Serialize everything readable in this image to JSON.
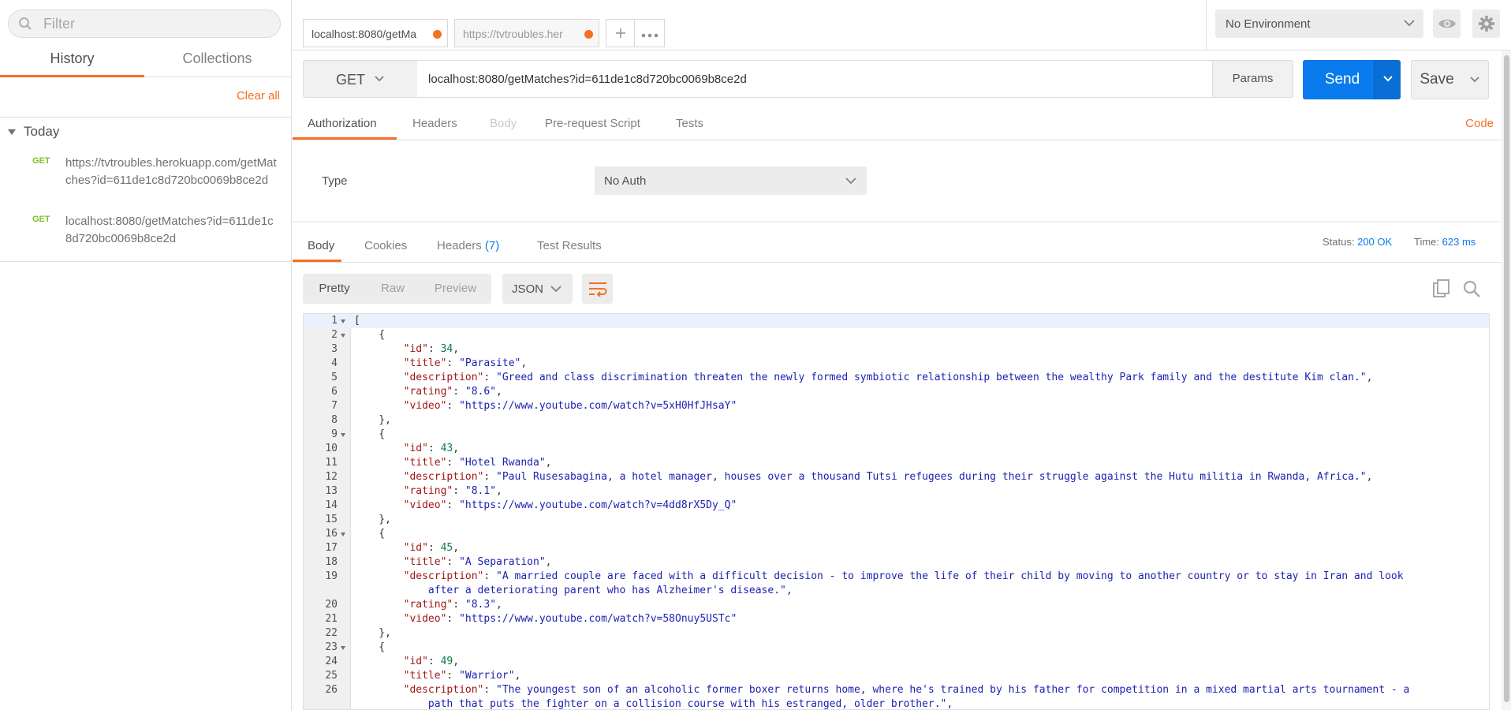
{
  "sidebar": {
    "filter_placeholder": "Filter",
    "tabs": [
      {
        "label": "History",
        "active": true
      },
      {
        "label": "Collections",
        "active": false
      }
    ],
    "clear_all": "Clear all",
    "group_label": "Today",
    "history": [
      {
        "method": "GET",
        "url": "https://tvtroubles.herokuapp.com/getMatches?id=611de1c8d720bc0069b8ce2d"
      },
      {
        "method": "GET",
        "url": "localhost:8080/getMatches?id=611de1c8d720bc0069b8ce2d"
      }
    ]
  },
  "tabs": [
    {
      "label": "localhost:8080/getMa",
      "unsaved": true,
      "active": true
    },
    {
      "label": "https://tvtroubles.her",
      "unsaved": true,
      "active": false
    }
  ],
  "environment": {
    "selected": "No Environment"
  },
  "request": {
    "method": "GET",
    "url": "localhost:8080/getMatches?id=611de1c8d720bc0069b8ce2d",
    "params_label": "Params",
    "send_label": "Send",
    "save_label": "Save"
  },
  "request_tabs": [
    {
      "label": "Authorization",
      "state": "active"
    },
    {
      "label": "Headers",
      "state": "normal"
    },
    {
      "label": "Body",
      "state": "disabled"
    },
    {
      "label": "Pre-request Script",
      "state": "normal"
    },
    {
      "label": "Tests",
      "state": "normal"
    }
  ],
  "code_link": "Code",
  "auth": {
    "type_label": "Type",
    "selected": "No Auth"
  },
  "response": {
    "tabs": [
      {
        "label": "Body",
        "count": ""
      },
      {
        "label": "Cookies",
        "count": ""
      },
      {
        "label": "Headers",
        "count": "(7)"
      },
      {
        "label": "Test Results",
        "count": ""
      }
    ],
    "status_label": "Status:",
    "status_value": "200 OK",
    "time_label": "Time:",
    "time_value": "623 ms",
    "view_modes": [
      "Pretty",
      "Raw",
      "Preview"
    ],
    "active_view": "Pretty",
    "format": "JSON"
  },
  "body_lines": [
    {
      "n": "1",
      "fold": true,
      "text": "["
    },
    {
      "n": "2",
      "fold": true,
      "text": "    {"
    },
    {
      "n": "3",
      "text": "        \"id\": 34,"
    },
    {
      "n": "4",
      "text": "        \"title\": \"Parasite\","
    },
    {
      "n": "5",
      "text": "        \"description\": \"Greed and class discrimination threaten the newly formed symbiotic relationship between the wealthy Park family and the destitute Kim clan.\","
    },
    {
      "n": "6",
      "text": "        \"rating\": \"8.6\","
    },
    {
      "n": "7",
      "text": "        \"video\": \"https://www.youtube.com/watch?v=5xH0HfJHsaY\""
    },
    {
      "n": "8",
      "text": "    },"
    },
    {
      "n": "9",
      "fold": true,
      "text": "    {"
    },
    {
      "n": "10",
      "text": "        \"id\": 43,"
    },
    {
      "n": "11",
      "text": "        \"title\": \"Hotel Rwanda\","
    },
    {
      "n": "12",
      "text": "        \"description\": \"Paul Rusesabagina, a hotel manager, houses over a thousand Tutsi refugees during their struggle against the Hutu militia in Rwanda, Africa.\","
    },
    {
      "n": "13",
      "text": "        \"rating\": \"8.1\","
    },
    {
      "n": "14",
      "text": "        \"video\": \"https://www.youtube.com/watch?v=4dd8rX5Dy_Q\""
    },
    {
      "n": "15",
      "text": "    },"
    },
    {
      "n": "16",
      "fold": true,
      "text": "    {"
    },
    {
      "n": "17",
      "text": "        \"id\": 45,"
    },
    {
      "n": "18",
      "text": "        \"title\": \"A Separation\","
    },
    {
      "n": "19",
      "text": "        \"description\": \"A married couple are faced with a difficult decision - to improve the life of their child by moving to another country or to stay in Iran and look"
    },
    {
      "n": "",
      "text": "            after a deteriorating parent who has Alzheimer's disease.\","
    },
    {
      "n": "20",
      "text": "        \"rating\": \"8.3\","
    },
    {
      "n": "21",
      "text": "        \"video\": \"https://www.youtube.com/watch?v=58Onuy5USTc\""
    },
    {
      "n": "22",
      "text": "    },"
    },
    {
      "n": "23",
      "fold": true,
      "text": "    {"
    },
    {
      "n": "24",
      "text": "        \"id\": 49,"
    },
    {
      "n": "25",
      "text": "        \"title\": \"Warrior\","
    },
    {
      "n": "26",
      "text": "        \"description\": \"The youngest son of an alcoholic former boxer returns home, where he's trained by his father for competition in a mixed martial arts tournament - a"
    },
    {
      "n": "",
      "text": "            path that puts the fighter on a collision course with his estranged, older brother.\","
    }
  ],
  "colors": {
    "accent": "#f47023",
    "primary": "#097bed",
    "method_get": "#7ec228"
  }
}
